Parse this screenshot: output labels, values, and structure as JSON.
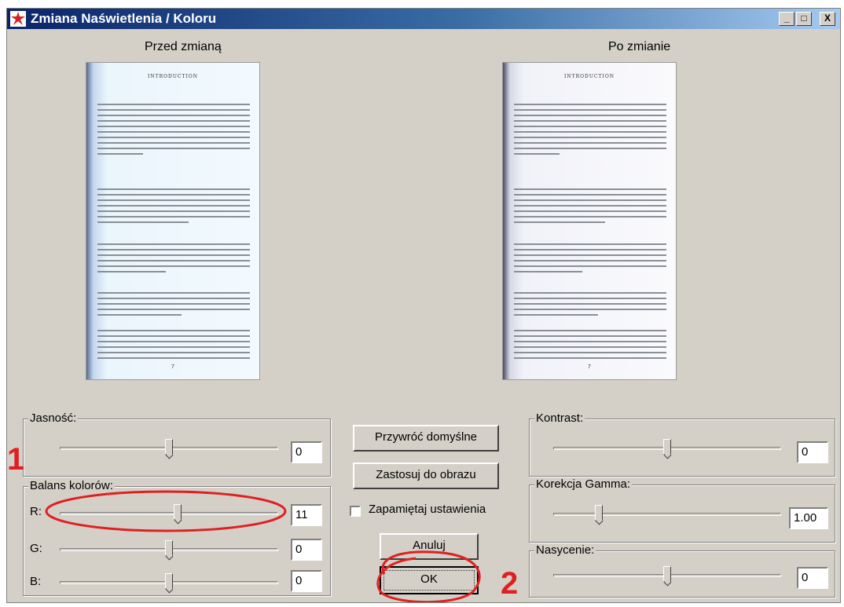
{
  "window": {
    "title": "Zmiana Naświetlenia / Koloru"
  },
  "titlebar_buttons": {
    "minimize": "_",
    "maximize": "□",
    "close": "X"
  },
  "preview": {
    "before_label": "Przed zmianą",
    "after_label": "Po zmianie",
    "doc_heading": "INTRODUCTION",
    "doc_page_number": "7"
  },
  "jasnosc": {
    "label": "Jasność:",
    "value": "0",
    "level": 0.5
  },
  "balans": {
    "label": "Balans kolorów:",
    "r": {
      "label": "R:",
      "value": "11",
      "level": 0.54
    },
    "g": {
      "label": "G:",
      "value": "0",
      "level": 0.5
    },
    "b": {
      "label": "B:",
      "value": "0",
      "level": 0.5
    }
  },
  "buttons": {
    "defaults": "Przywróć domyślne",
    "apply": "Zastosuj do obrazu",
    "cancel": "Anuluj",
    "ok": "OK"
  },
  "remember": {
    "label": "Zapamiętaj ustawienia",
    "checked": false
  },
  "kontrast": {
    "label": "Kontrast:",
    "value": "0",
    "level": 0.5
  },
  "gamma": {
    "label": "Korekcja Gamma:",
    "value": "1.00",
    "level": 0.2
  },
  "nasycenie": {
    "label": "Nasycenie:",
    "value": "0",
    "level": 0.5
  },
  "annotations": {
    "one": "1",
    "two": "2",
    "color": "#e02020"
  }
}
